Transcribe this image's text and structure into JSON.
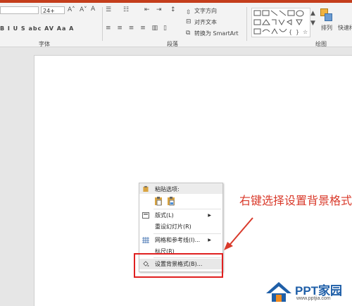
{
  "ribbon": {
    "font_size": "24+",
    "font_controls": "B  I  U  S  abc  AV  Aa  A",
    "text_direction": "文字方向",
    "align_text": "对齐文本",
    "convert_smartart": "转换为 SmartArt",
    "arrange_label": "排列",
    "quick_styles_label": "快速样",
    "groups": {
      "font": "字体",
      "paragraph": "段落",
      "drawing": "绘图"
    }
  },
  "context_menu": {
    "paste_options": "粘贴选项:",
    "items": [
      {
        "label": "版式(L)",
        "submenu": true
      },
      {
        "label": "重设幻灯片(R)",
        "submenu": false
      },
      {
        "label": "网格和参考线(I)...",
        "submenu": true
      },
      {
        "label": "标尺(R)",
        "submenu": false
      },
      {
        "label": "设置背景格式(B)...",
        "submenu": false
      }
    ]
  },
  "annotation": {
    "text": "右键选择设置背景格式"
  },
  "logo": {
    "name": "PPT家园",
    "url": "www.pptjia.com"
  },
  "colors": {
    "accent": "#c43e1c",
    "highlight": "#e02020",
    "annotation": "#d93a2b",
    "logo_blue": "#1f5fa8",
    "logo_orange": "#f08a1c"
  }
}
